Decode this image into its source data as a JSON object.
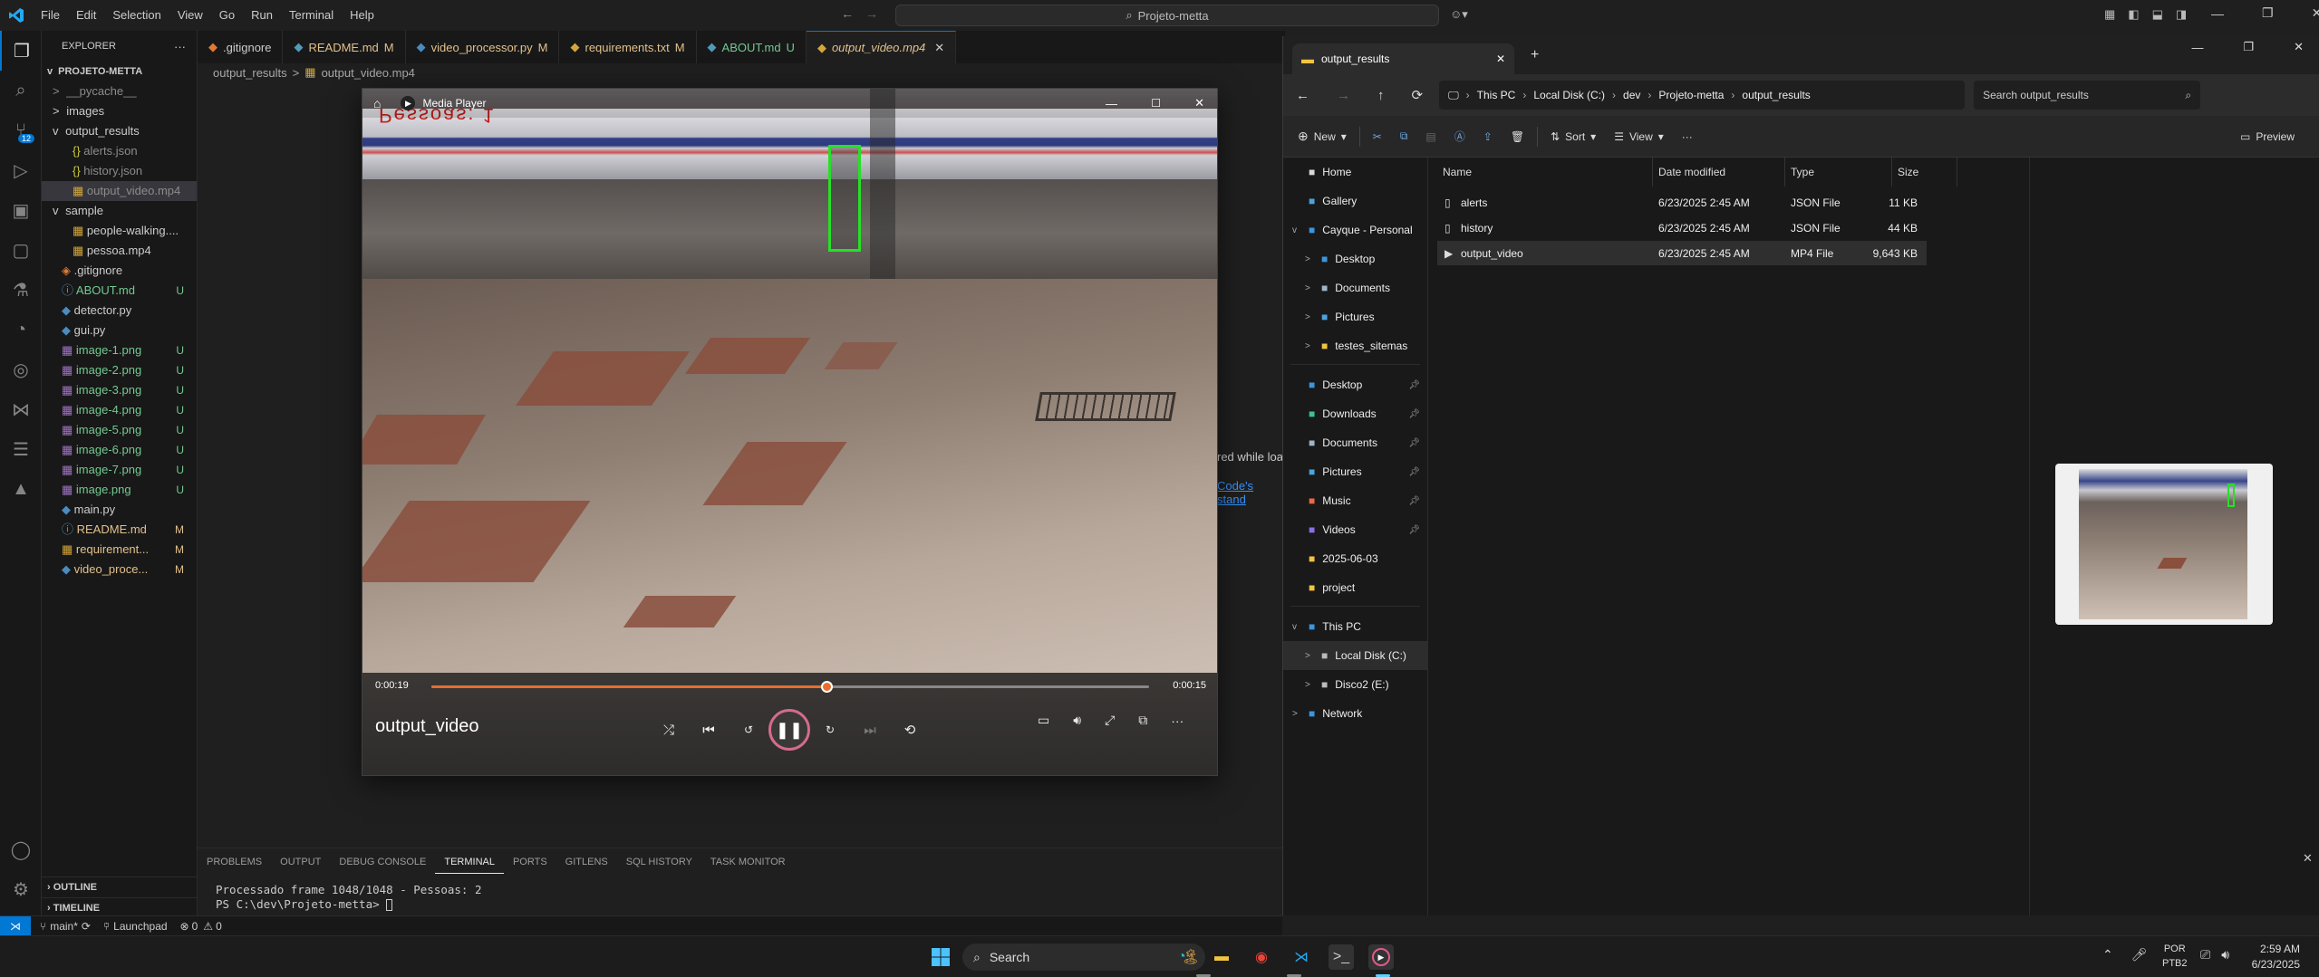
{
  "vscode": {
    "menu": [
      "File",
      "Edit",
      "Selection",
      "View",
      "Go",
      "Run",
      "Terminal",
      "Help"
    ],
    "search_title": "Projeto-metta",
    "explorer_label": "EXPLORER",
    "project": "PROJETO-METTA",
    "tree": [
      {
        "label": "__pycache__",
        "badge": "",
        "cls": "git-ign",
        "indent": 1,
        "chev": ">"
      },
      {
        "label": "images",
        "badge": "",
        "cls": "",
        "indent": 1,
        "chev": ">"
      },
      {
        "label": "output_results",
        "badge": "",
        "cls": "",
        "indent": 1,
        "chev": "v"
      },
      {
        "label": "alerts.json",
        "badge": "",
        "cls": "git-ign",
        "indent": 2,
        "chev": ""
      },
      {
        "label": "history.json",
        "badge": "",
        "cls": "git-ign",
        "indent": 2,
        "chev": ""
      },
      {
        "label": "output_video.mp4",
        "badge": "",
        "cls": "git-ign",
        "indent": 2,
        "chev": "",
        "selected": true
      },
      {
        "label": "sample",
        "badge": "",
        "cls": "",
        "indent": 1,
        "chev": "v"
      },
      {
        "label": "people-walking....",
        "badge": "",
        "cls": "",
        "indent": 2,
        "chev": ""
      },
      {
        "label": "pessoa.mp4",
        "badge": "",
        "cls": "",
        "indent": 2,
        "chev": ""
      },
      {
        "label": ".gitignore",
        "badge": "",
        "cls": "",
        "indent": 1,
        "chev": ""
      },
      {
        "label": "ABOUT.md",
        "badge": "U",
        "cls": "git-u",
        "indent": 1,
        "chev": ""
      },
      {
        "label": "detector.py",
        "badge": "",
        "cls": "",
        "indent": 1,
        "chev": ""
      },
      {
        "label": "gui.py",
        "badge": "",
        "cls": "",
        "indent": 1,
        "chev": ""
      },
      {
        "label": "image-1.png",
        "badge": "U",
        "cls": "git-u",
        "indent": 1,
        "chev": ""
      },
      {
        "label": "image-2.png",
        "badge": "U",
        "cls": "git-u",
        "indent": 1,
        "chev": ""
      },
      {
        "label": "image-3.png",
        "badge": "U",
        "cls": "git-u",
        "indent": 1,
        "chev": ""
      },
      {
        "label": "image-4.png",
        "badge": "U",
        "cls": "git-u",
        "indent": 1,
        "chev": ""
      },
      {
        "label": "image-5.png",
        "badge": "U",
        "cls": "git-u",
        "indent": 1,
        "chev": ""
      },
      {
        "label": "image-6.png",
        "badge": "U",
        "cls": "git-u",
        "indent": 1,
        "chev": ""
      },
      {
        "label": "image-7.png",
        "badge": "U",
        "cls": "git-u",
        "indent": 1,
        "chev": ""
      },
      {
        "label": "image.png",
        "badge": "U",
        "cls": "git-u",
        "indent": 1,
        "chev": ""
      },
      {
        "label": "main.py",
        "badge": "",
        "cls": "",
        "indent": 1,
        "chev": ""
      },
      {
        "label": "README.md",
        "badge": "M",
        "cls": "git-m",
        "indent": 1,
        "chev": ""
      },
      {
        "label": "requirement...",
        "badge": "M",
        "cls": "git-m",
        "indent": 1,
        "chev": ""
      },
      {
        "label": "video_proce...",
        "badge": "M",
        "cls": "git-m",
        "indent": 1,
        "chev": ""
      }
    ],
    "outline": "OUTLINE",
    "timeline": "TIMELINE",
    "tabs": [
      {
        "label": ".gitignore",
        "badge": "",
        "icon_color": "#e37933"
      },
      {
        "label": "README.md",
        "badge": "M",
        "icon_color": "#519aba"
      },
      {
        "label": "video_processor.py",
        "badge": "M",
        "icon_color": "#4b8bbe"
      },
      {
        "label": "requirements.txt",
        "badge": "M",
        "icon_color": "#d4a73b"
      },
      {
        "label": "ABOUT.md",
        "badge": "U",
        "icon_color": "#519aba"
      },
      {
        "label": "output_video.mp4",
        "badge": "",
        "icon_color": "#d4a73b",
        "active": true
      }
    ],
    "breadcrumb": [
      "output_results",
      ">",
      "output_video.mp4"
    ],
    "behind_text_1": "red while loa",
    "behind_text_2": "Code's stand",
    "panel_tabs": [
      "PROBLEMS",
      "OUTPUT",
      "DEBUG CONSOLE",
      "TERMINAL",
      "PORTS",
      "GITLENS",
      "SQL HISTORY",
      "TASK MONITOR"
    ],
    "terminal_lines": [
      "Processado frame 1048/1048 - Pessoas: 2",
      "PS C:\\dev\\Projeto-metta> "
    ],
    "status": {
      "branch": "main*",
      "launchpad": "Launchpad",
      "errors": "0",
      "warnings": "0"
    }
  },
  "player": {
    "title": "Media Player",
    "overlay_text": "Pessoas: 1",
    "time_elapsed": "0:00:19",
    "time_total": "0:00:15",
    "progress": 0.55,
    "video_title": "output_video"
  },
  "explorer": {
    "tab_title": "output_results",
    "path": [
      "This PC",
      "Local Disk (C:)",
      "dev",
      "Projeto-metta",
      "output_results"
    ],
    "search_placeholder": "Search output_results",
    "cmd": {
      "new": "New",
      "sort": "Sort",
      "view": "View",
      "preview": "Preview"
    },
    "nav": [
      {
        "label": "Home",
        "icon": "home-icon",
        "color": "#d9d9d9",
        "indent": 0,
        "pin": false
      },
      {
        "label": "Gallery",
        "icon": "gallery-icon",
        "color": "#4aa3df",
        "indent": 0,
        "pin": false
      },
      {
        "label": "Cayque - Personal",
        "icon": "cloud-icon",
        "color": "#3a96dd",
        "indent": 0,
        "pin": false,
        "chev": "v"
      },
      {
        "label": "Desktop",
        "icon": "desktop-icon",
        "color": "#3a96dd",
        "indent": 1,
        "pin": false,
        "chev": ">"
      },
      {
        "label": "Documents",
        "icon": "documents-icon",
        "color": "#9fb6c9",
        "indent": 1,
        "pin": false,
        "chev": ">"
      },
      {
        "label": "Pictures",
        "icon": "pictures-icon",
        "color": "#4aa3df",
        "indent": 1,
        "pin": false,
        "chev": ">"
      },
      {
        "label": "testes_sitemas",
        "icon": "folder-icon",
        "color": "#f3c440",
        "indent": 1,
        "pin": false,
        "chev": ">"
      },
      {
        "label": "",
        "sep": true
      },
      {
        "label": "Desktop",
        "icon": "desktop-icon",
        "color": "#3a96dd",
        "indent": 0,
        "pin": true
      },
      {
        "label": "Downloads",
        "icon": "downloads-icon",
        "color": "#3dc28f",
        "indent": 0,
        "pin": true
      },
      {
        "label": "Documents",
        "icon": "documents-icon",
        "color": "#9fb6c9",
        "indent": 0,
        "pin": true
      },
      {
        "label": "Pictures",
        "icon": "pictures-icon",
        "color": "#4aa3df",
        "indent": 0,
        "pin": true
      },
      {
        "label": "Music",
        "icon": "music-icon",
        "color": "#e8694a",
        "indent": 0,
        "pin": true
      },
      {
        "label": "Videos",
        "icon": "videos-icon",
        "color": "#8c6ee8",
        "indent": 0,
        "pin": true
      },
      {
        "label": "2025-06-03",
        "icon": "folder-icon",
        "color": "#f3c440",
        "indent": 0,
        "pin": false
      },
      {
        "label": "project",
        "icon": "folder-icon",
        "color": "#f3c440",
        "indent": 0,
        "pin": false
      },
      {
        "label": "",
        "sep": true
      },
      {
        "label": "This PC",
        "icon": "pc-icon",
        "color": "#3a96dd",
        "indent": 0,
        "pin": false,
        "chev": "v"
      },
      {
        "label": "Local Disk (C:)",
        "icon": "disk-icon",
        "color": "#bbb",
        "indent": 1,
        "pin": false,
        "chev": ">",
        "selected": true
      },
      {
        "label": "Disco2 (E:)",
        "icon": "disk-icon",
        "color": "#bbb",
        "indent": 1,
        "pin": false,
        "chev": ">"
      },
      {
        "label": "Network",
        "icon": "network-icon",
        "color": "#3a96dd",
        "indent": 0,
        "pin": false,
        "chev": ">"
      }
    ],
    "columns": [
      "Name",
      "Date modified",
      "Type",
      "Size"
    ],
    "files": [
      {
        "name": "alerts",
        "date": "6/23/2025 2:45 AM",
        "type": "JSON File",
        "size": "11 KB"
      },
      {
        "name": "history",
        "date": "6/23/2025 2:45 AM",
        "type": "JSON File",
        "size": "44 KB"
      },
      {
        "name": "output_video",
        "date": "6/23/2025 2:45 AM",
        "type": "MP4 File",
        "size": "9,643 KB",
        "selected": true
      }
    ]
  },
  "taskbar": {
    "search": "Search",
    "lang": "POR",
    "layout": "PTB2",
    "time": "2:59 AM",
    "date": "6/23/2025"
  }
}
